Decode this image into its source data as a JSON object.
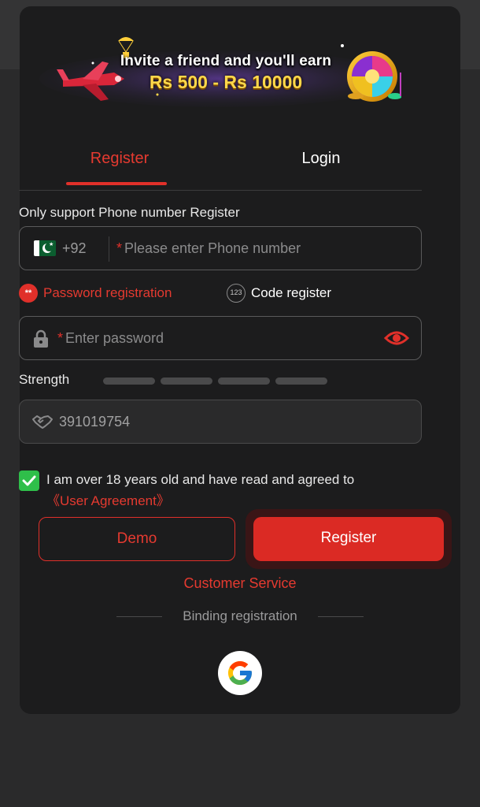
{
  "banner": {
    "line1": "Invite a friend and you'll earn",
    "line2": "Rs 500 - Rs 10000"
  },
  "tabs": [
    {
      "label": "Register",
      "active": true
    },
    {
      "label": "Login",
      "active": false
    }
  ],
  "phone": {
    "label": "Only support Phone number Register",
    "country_flag": "pakistan-flag-icon",
    "dial_code": "+92",
    "required_mark": "*",
    "placeholder": "Please enter Phone number",
    "value": ""
  },
  "registration_modes": {
    "password": {
      "icon_text": "**",
      "label": "Password registration",
      "selected": true
    },
    "code": {
      "icon_text": "123",
      "label": "Code register",
      "selected": false
    }
  },
  "password": {
    "required_mark": "*",
    "placeholder": "Enter password",
    "value": "",
    "icon": "lock-icon",
    "toggle_icon": "eye-icon"
  },
  "strength": {
    "label": "Strength",
    "levels": 4,
    "filled": 0
  },
  "invite_code": {
    "icon": "handshake-icon",
    "value": "391019754"
  },
  "agreement": {
    "checked": true,
    "text": "I am over 18 years old and have read and agreed to",
    "link": "《User Agreement》"
  },
  "buttons": {
    "demo": "Demo",
    "register": "Register"
  },
  "customer_service": "Customer Service",
  "binding_label": "Binding registration",
  "colors": {
    "accent": "#e0302a",
    "background": "#1c1c1d",
    "checkbox": "#2fbf4a"
  }
}
